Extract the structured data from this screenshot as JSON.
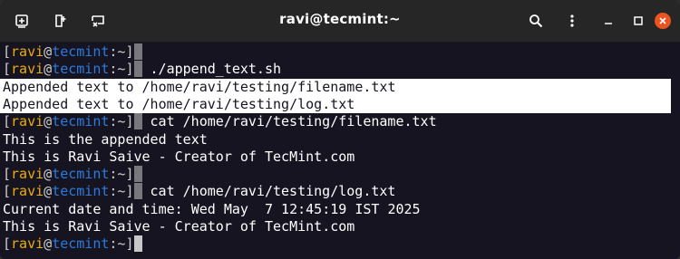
{
  "window": {
    "title": "ravi@tecmint:~",
    "toolbar_icons": [
      "new-tab-icon",
      "split-terminal-icon",
      "remote-connection-icon"
    ],
    "controls": [
      "search-icon",
      "menu-icon",
      "minimize-icon",
      "maximize-icon",
      "close-icon"
    ],
    "accent": "#e95420"
  },
  "prompt": {
    "open_bracket": "[",
    "user": "ravi",
    "at": "@",
    "host": "tecmint",
    "sep": ":~",
    "close_bracket": "]"
  },
  "lines": [
    {
      "type": "prompt",
      "command": ""
    },
    {
      "type": "prompt",
      "command": "./append_text.sh"
    },
    {
      "type": "output",
      "text": "Appended text to /home/ravi/testing/filename.txt",
      "highlighted": true
    },
    {
      "type": "output",
      "text": "Appended text to /home/ravi/testing/log.txt",
      "highlighted": true
    },
    {
      "type": "prompt",
      "command": "cat /home/ravi/testing/filename.txt"
    },
    {
      "type": "output",
      "text": "This is the appended text"
    },
    {
      "type": "output",
      "text": "This is Ravi Saive - Creator of TecMint.com"
    },
    {
      "type": "prompt",
      "command": ""
    },
    {
      "type": "prompt",
      "command": "cat /home/ravi/testing/log.txt"
    },
    {
      "type": "output",
      "text": "Current date and time: Wed May  7 12:45:19 IST 2025"
    },
    {
      "type": "output",
      "text": "This is Ravi Saive - Creator of TecMint.com"
    },
    {
      "type": "prompt",
      "command": "",
      "active": true
    }
  ],
  "colors": {
    "background": "#171421",
    "user": "#e9ad0c",
    "host": "#2a7bde",
    "text": "#ffffff"
  }
}
